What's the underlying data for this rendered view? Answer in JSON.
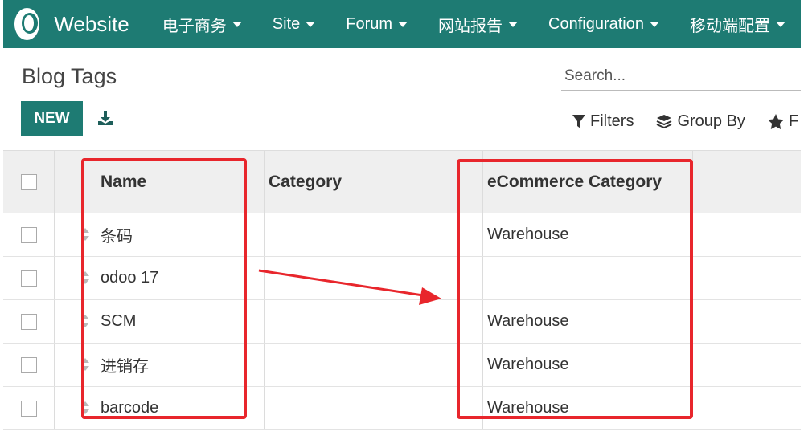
{
  "navbar": {
    "app_name": "Website",
    "menus": [
      "电子商务",
      "Site",
      "Forum",
      "网站报告",
      "Configuration",
      "移动端配置"
    ]
  },
  "control": {
    "title": "Blog Tags",
    "new_label": "NEW",
    "search_placeholder": "Search...",
    "filters_label": "Filters",
    "groupby_label": "Group By",
    "favorites_label": "F"
  },
  "table": {
    "columns": [
      "Name",
      "Category",
      "eCommerce Category"
    ],
    "rows": [
      {
        "name": "条码",
        "category": "",
        "ecommerce_category": "Warehouse"
      },
      {
        "name": "odoo 17",
        "category": "",
        "ecommerce_category": ""
      },
      {
        "name": "SCM",
        "category": "",
        "ecommerce_category": "Warehouse"
      },
      {
        "name": "进销存",
        "category": "",
        "ecommerce_category": "Warehouse"
      },
      {
        "name": "barcode",
        "category": "",
        "ecommerce_category": "Warehouse"
      }
    ]
  },
  "colors": {
    "brand": "#1e7b73",
    "annotation": "#e8262c"
  }
}
